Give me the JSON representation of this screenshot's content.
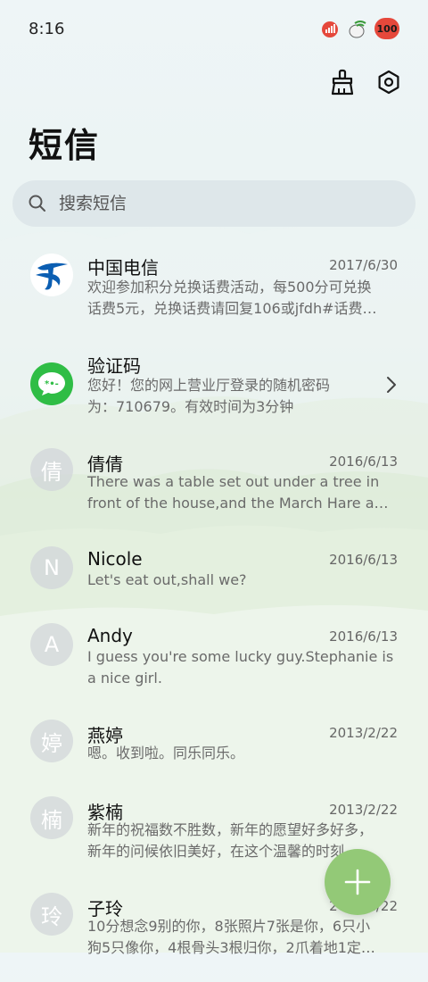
{
  "status_bar": {
    "time": "8:16",
    "battery": "100"
  },
  "header": {
    "title": "短信",
    "clean_icon": "broom-icon",
    "settings_icon": "gear-icon"
  },
  "search": {
    "placeholder": "搜索短信"
  },
  "conversations": [
    {
      "name": "中国电信",
      "date": "2017/6/30",
      "line1": "欢迎参加积分兑换话费活动，每500分可兑换",
      "line2": "话费5元，兑换话费请回复106或jfdh#话费…",
      "avatar": "china-telecom-logo"
    },
    {
      "name": "验证码",
      "date": "",
      "line1": "您好！您的网上营业厅登录的随机密码",
      "line2": "为：710679。有效时间为3分钟",
      "avatar": "message-icon"
    },
    {
      "name": "倩倩",
      "date": "2016/6/13",
      "line1": "There was a table set out under a tree in",
      "line2": "front of the house,and the March Hare an…",
      "avatar_letter": "倩"
    },
    {
      "name": "Nicole",
      "date": "2016/6/13",
      "line1": "Let's eat out,shall we?",
      "line2": "",
      "avatar_letter": "N"
    },
    {
      "name": "Andy",
      "date": "2016/6/13",
      "line1": "I guess you're some lucky guy.Stephanie is",
      "line2": "a nice girl.",
      "avatar_letter": "A"
    },
    {
      "name": "燕婷",
      "date": "2013/2/22",
      "line1": "嗯。收到啦。同乐同乐。",
      "line2": "",
      "avatar_letter": "婷"
    },
    {
      "name": "紫楠",
      "date": "2013/2/22",
      "line1": "新年的祝福数不胜数，新年的愿望好多好多，",
      "line2": "新年的问候依旧美好，在这个温馨的时刻…",
      "avatar_letter": "楠"
    },
    {
      "name": "子玲",
      "date": "2013/2/22",
      "line1": "10分想念9别的你，8张照片7张是你，6只小",
      "line2": "狗5只像你，4根骨头3根归你，2爪着地1定…",
      "avatar_letter": "玲"
    }
  ],
  "fab": {
    "icon": "plus-icon"
  },
  "colors": {
    "accent": "#93c977",
    "telecom_blue": "#0b5eb2",
    "message_green": "#2fbd45"
  }
}
